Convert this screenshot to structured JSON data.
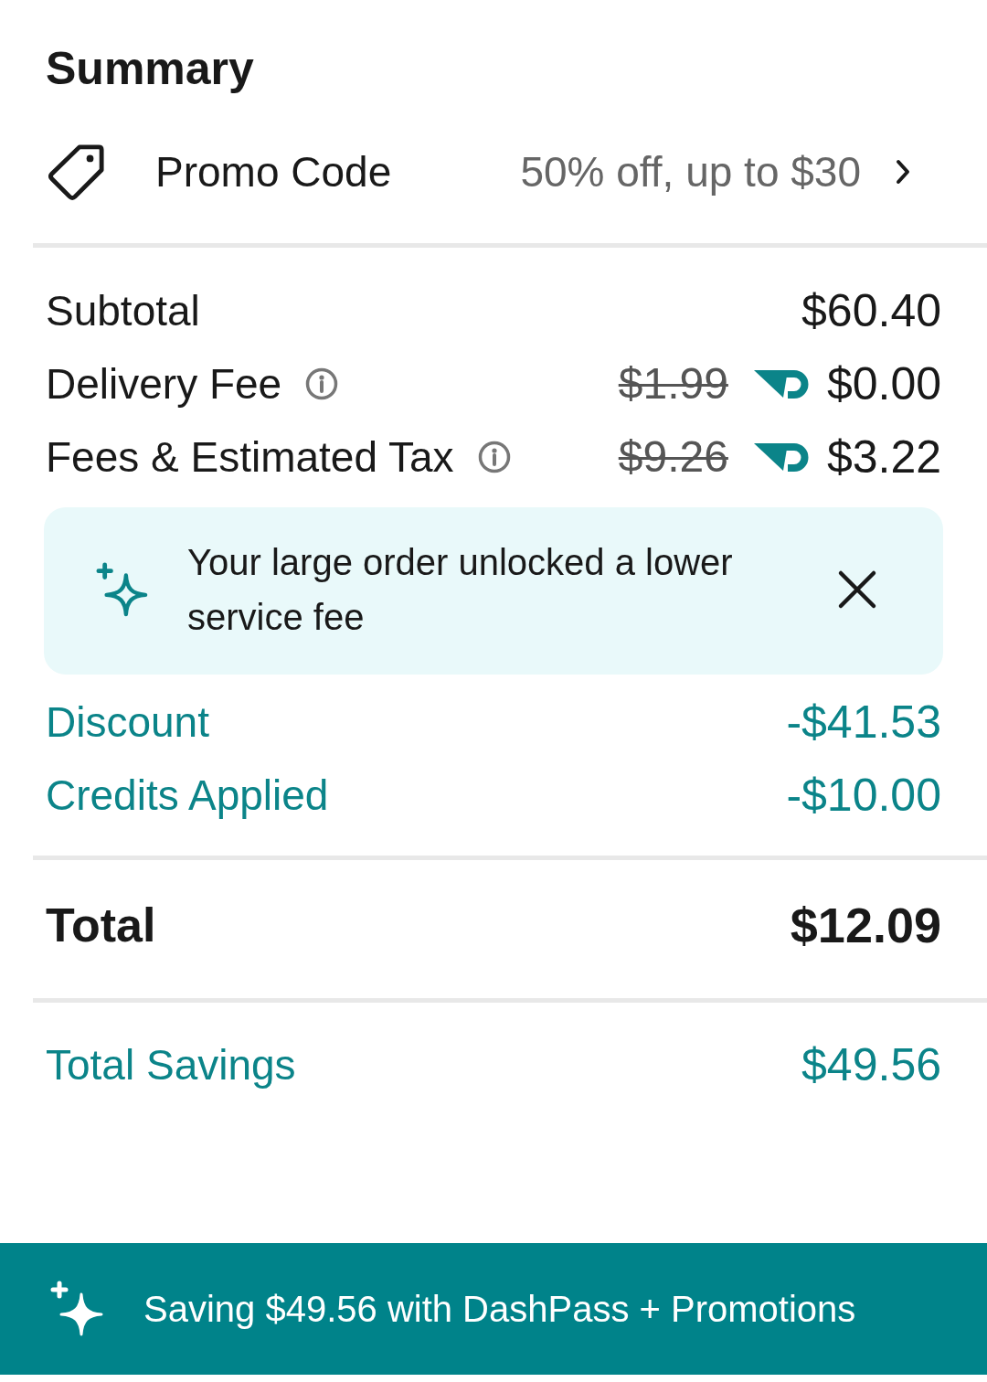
{
  "title": "Summary",
  "promo": {
    "label": "Promo Code",
    "value": "50% off, up to $30"
  },
  "charges": [
    {
      "kind": "plain",
      "label": "Subtotal",
      "info": false,
      "amount": "$60.40"
    },
    {
      "kind": "dashpass",
      "label": "Delivery Fee",
      "info": true,
      "original_amount": "$1.99",
      "amount": "$0.00"
    },
    {
      "kind": "dashpass",
      "label": "Fees & Estimated Tax",
      "info": true,
      "original_amount": "$9.26",
      "amount": "$3.22"
    }
  ],
  "notice": {
    "text": "Your large order unlocked a lower service fee"
  },
  "credits": [
    {
      "label": "Discount",
      "amount": "-$41.53"
    },
    {
      "label": "Credits Applied",
      "amount": "-$10.00"
    }
  ],
  "total": {
    "label": "Total",
    "amount": "$12.09"
  },
  "savings": {
    "label": "Total Savings",
    "amount": "$49.56"
  },
  "banner": {
    "text": "Saving $49.56 with DashPass + Promotions"
  }
}
